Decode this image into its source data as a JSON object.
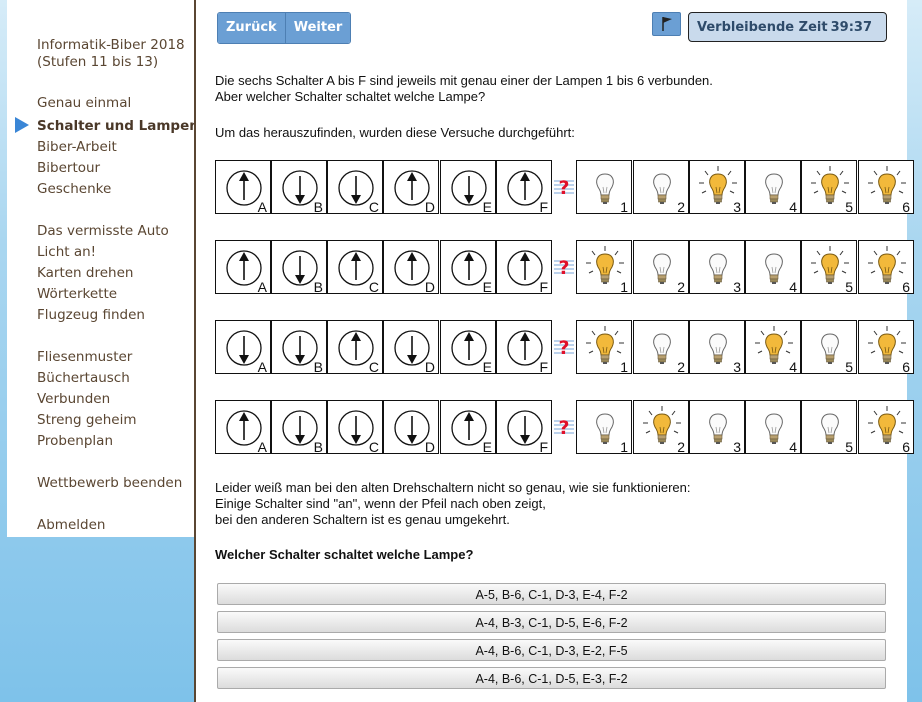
{
  "sidebar": {
    "title_line1": "Informatik-Biber 2018",
    "title_line2": "(Stufen 11 bis 13)",
    "items": [
      "Genau einmal",
      "Schalter und Lampen",
      "Biber-Arbeit",
      "Bibertour",
      "Geschenke",
      "Das vermisste Auto",
      "Licht an!",
      "Karten drehen",
      "Wörterkette",
      "Flugzeug finden",
      "Fliesenmuster",
      "Büchertausch",
      "Verbunden",
      "Streng geheim",
      "Probenplan",
      "Wettbewerb beenden",
      "Abmelden"
    ],
    "active_index": 1
  },
  "toolbar": {
    "back_label": "Zurück",
    "next_label": "Weiter",
    "timer_label": "Verbleibende Zeit",
    "timer_value": "39:37",
    "flag_icon": "flag-icon"
  },
  "task": {
    "intro_line1": "Die sechs Schalter A bis F sind jeweils mit genau einer der Lampen 1 bis 6 verbunden.",
    "intro_line2": "Aber welcher Schalter schaltet welche Lampe?",
    "experiments_intro": "Um das herauszufinden, wurden diese Versuche durchgeführt:",
    "switch_letters": [
      "A",
      "B",
      "C",
      "D",
      "E",
      "F"
    ],
    "lamp_numbers": [
      "1",
      "2",
      "3",
      "4",
      "5",
      "6"
    ],
    "experiments": [
      {
        "switches": [
          "up",
          "down",
          "down",
          "up",
          "down",
          "up"
        ],
        "lamps": [
          false,
          false,
          true,
          false,
          true,
          true
        ]
      },
      {
        "switches": [
          "up",
          "down",
          "up",
          "up",
          "up",
          "up"
        ],
        "lamps": [
          true,
          false,
          false,
          false,
          true,
          true
        ]
      },
      {
        "switches": [
          "down",
          "down",
          "up",
          "down",
          "up",
          "up"
        ],
        "lamps": [
          true,
          false,
          false,
          true,
          false,
          true
        ]
      },
      {
        "switches": [
          "up",
          "down",
          "down",
          "down",
          "up",
          "down"
        ],
        "lamps": [
          false,
          true,
          false,
          false,
          false,
          true
        ]
      }
    ],
    "note_line1": "Leider weiß man bei den alten Drehschaltern nicht so genau, wie sie funktionieren:",
    "note_line2": "Einige Schalter sind \"an\", wenn der Pfeil nach oben zeigt,",
    "note_line3": "bei den anderen Schaltern ist es genau umgekehrt.",
    "question": "Welcher Schalter schaltet welche Lampe?",
    "answers": [
      "A-5, B-6, C-1, D-3, E-4, F-2",
      "A-4, B-3, C-1, D-5, E-6, F-2",
      "A-4, B-6, C-1, D-3, E-2, F-5",
      "A-4, B-6, C-1, D-5, E-3, F-2"
    ]
  },
  "colors": {
    "accent": "#6b9fd4",
    "sidebar_text": "#5a4632",
    "active_arrow": "#3a86d6",
    "lamp_on": "#f2b93b",
    "question_mark": "#e0102a"
  }
}
